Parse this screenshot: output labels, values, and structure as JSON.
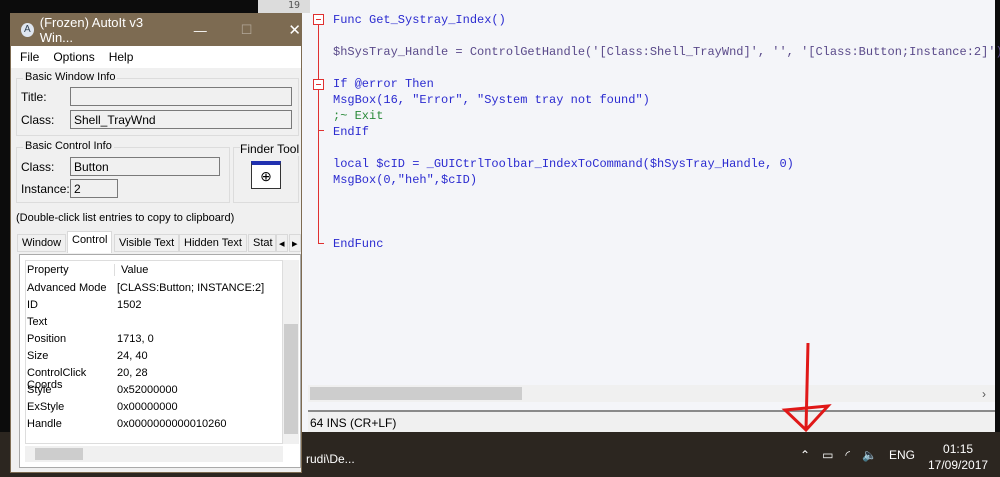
{
  "editor": {
    "line_number": "19",
    "status": "64 INS (CR+LF)",
    "code": [
      [
        "Func Get_Systray_Index()"
      ],
      [
        ""
      ],
      [
        "$hSysTray_Handle = ControlGetHandle('[Class:Shell_TrayWnd]', '', '[Class:Button;Instance:2]')"
      ],
      [
        ""
      ],
      [
        "If @error Then"
      ],
      [
        "MsgBox(16, \"Error\", \"System tray not found\")"
      ],
      [
        ";~ Exit"
      ],
      [
        "EndIf"
      ],
      [
        ""
      ],
      [
        "local $cID = _GUICtrlToolbar_IndexToCommand($hSysTray_Handle, 0)"
      ],
      [
        "MsgBox(0,\"heh\",$cID)"
      ],
      [
        ""
      ],
      [
        ""
      ],
      [
        ""
      ],
      [
        "EndFunc"
      ]
    ]
  },
  "window": {
    "title": "(Frozen) AutoIt v3 Win...",
    "menu": [
      "File",
      "Options",
      "Help"
    ],
    "basic_window_info": {
      "label": "Basic Window Info",
      "title_label": "Title:",
      "title_value": "",
      "class_label": "Class:",
      "class_value": "Shell_TrayWnd"
    },
    "basic_control_info": {
      "label": "Basic Control Info",
      "class_label": "Class:",
      "class_value": "Button",
      "instance_label": "Instance:",
      "instance_value": "2"
    },
    "finder_tool": "Finder Tool",
    "hint": "(Double-click list entries to copy to clipboard)",
    "tabs": [
      "Window",
      "Control",
      "Visible Text",
      "Hidden Text",
      "Stat"
    ],
    "active_tab": "Control",
    "columns": [
      "Property",
      "Value"
    ],
    "rows": [
      [
        "Advanced Mode",
        "[CLASS:Button; INSTANCE:2]"
      ],
      [
        "ID",
        "1502"
      ],
      [
        "Text",
        ""
      ],
      [
        "Position",
        "1713, 0"
      ],
      [
        "Size",
        "24, 40"
      ],
      [
        "ControlClick Coords",
        "20, 28"
      ],
      [
        "Style",
        "0x52000000"
      ],
      [
        "ExStyle",
        "0x00000000"
      ],
      [
        "Handle",
        "0x0000000000010260"
      ]
    ]
  },
  "taskbar": {
    "item": "rudi\\De...",
    "language": "ENG",
    "time": "01:15",
    "date": "17/09/2017"
  }
}
